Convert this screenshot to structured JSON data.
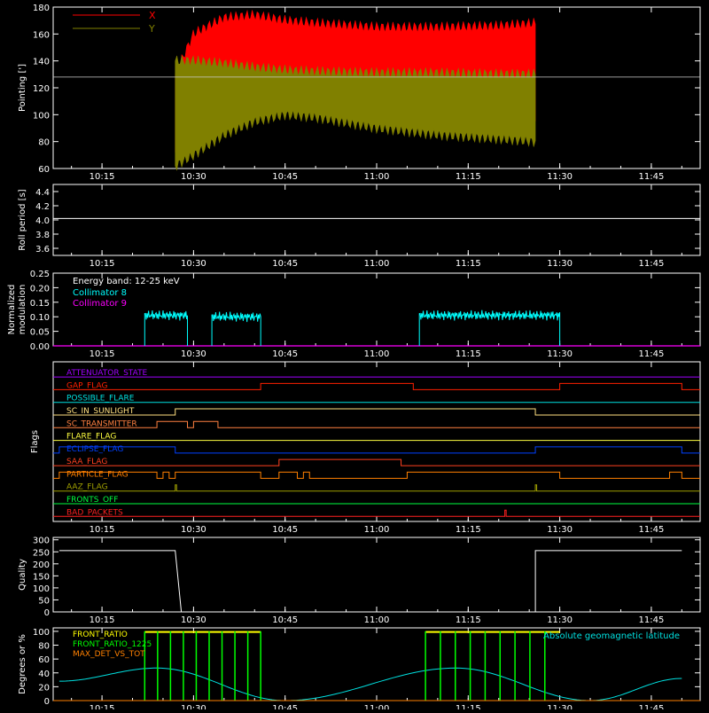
{
  "colors": {
    "background": "#000000",
    "axis": "#ffffff",
    "x_pointing": "#ff0000",
    "y_pointing": "#808000",
    "collimator8": "#00ffff",
    "collimator9": "#ff00ff",
    "front_ratio": "#ffff00",
    "front_ratio_1225": "#00ff00",
    "max_det_vs_tot": "#ff8000",
    "geomag": "#00e0e0"
  },
  "time_axis": {
    "ticks": [
      "10:15",
      "10:30",
      "10:45",
      "11:00",
      "11:15",
      "11:30",
      "11:45"
    ],
    "tick_minutes": [
      615,
      630,
      645,
      660,
      675,
      690,
      705
    ],
    "range_minutes": [
      607,
      713
    ]
  },
  "panels": {
    "pointing": {
      "ylabel": "Pointing [']",
      "yticks": [
        "60",
        "80",
        "100",
        "120",
        "140",
        "160",
        "180"
      ],
      "yrange": [
        60,
        180
      ],
      "legend": [
        {
          "name": "X",
          "color": "#ff0000"
        },
        {
          "name": "Y",
          "color": "#808000"
        }
      ]
    },
    "roll": {
      "ylabel": "Roll period [s]",
      "yticks": [
        "3.6",
        "3.8",
        "4.0",
        "4.2",
        "4.4"
      ],
      "yrange": [
        3.5,
        4.5
      ]
    },
    "modulation": {
      "ylabel_line1": "Normalized",
      "ylabel_line2": "modulation",
      "yticks": [
        "0.00",
        "0.05",
        "0.10",
        "0.15",
        "0.20",
        "0.25"
      ],
      "yrange": [
        0,
        0.25
      ],
      "legend_title": "Energy band: 12-25 keV",
      "legend": [
        {
          "name": "Collimator 8",
          "color": "#00ffff"
        },
        {
          "name": "Collimator 9",
          "color": "#ff00ff"
        }
      ]
    },
    "flags": {
      "ylabel": "Flags",
      "items": [
        {
          "name": "ATTENUATOR_STATE",
          "color": "#a000ff"
        },
        {
          "name": "GAP_FLAG",
          "color": "#ff2000"
        },
        {
          "name": "POSSIBLE_FLARE",
          "color": "#00e0e0"
        },
        {
          "name": "SC_IN_SUNLIGHT",
          "color": "#ffe080"
        },
        {
          "name": "SC_TRANSMITTER",
          "color": "#ff8040"
        },
        {
          "name": "FLARE_FLAG",
          "color": "#ffff40"
        },
        {
          "name": "ECLIPSE_FLAG",
          "color": "#0040ff"
        },
        {
          "name": "SAA_FLAG",
          "color": "#ff4020"
        },
        {
          "name": "PARTICLE_FLAG",
          "color": "#ff8000"
        },
        {
          "name": "AAZ_FLAG",
          "color": "#a0a000"
        },
        {
          "name": "FRONTS_OFF",
          "color": "#00ff40"
        },
        {
          "name": "BAD_PACKETS",
          "color": "#ff2020"
        }
      ]
    },
    "quality": {
      "ylabel": "Quality",
      "yticks": [
        "0",
        "50",
        "100",
        "150",
        "200",
        "250",
        "300"
      ],
      "yrange": [
        0,
        310
      ]
    },
    "degrees": {
      "ylabel": "Degrees or %",
      "yticks": [
        "0",
        "20",
        "40",
        "60",
        "80",
        "100"
      ],
      "yrange": [
        0,
        105
      ],
      "legend": [
        {
          "name": "FRONT_RATIO",
          "color": "#ffff00"
        },
        {
          "name": "FRONT_RATIO_1225",
          "color": "#00ff00"
        },
        {
          "name": "MAX_DET_VS_TOT",
          "color": "#ff8000"
        }
      ],
      "annotation": "Absolute geomagnetic latitude"
    }
  },
  "chart_data": {
    "type": "line",
    "x_unit": "time (HH:MM)",
    "pointing": {
      "x": [
        "10:27",
        "10:30",
        "10:35",
        "10:40",
        "10:45",
        "10:50",
        "11:00",
        "11:10",
        "11:20",
        "11:26"
      ],
      "series": [
        {
          "name": "X",
          "min": [
            72,
            85,
            100,
            108,
            110,
            105,
            100,
            98,
            97,
            95
          ],
          "max": [
            130,
            160,
            172,
            174,
            170,
            168,
            165,
            165,
            166,
            168
          ]
        },
        {
          "name": "Y",
          "min": [
            62,
            70,
            85,
            95,
            100,
            98,
            90,
            85,
            82,
            80
          ],
          "max": [
            140,
            140,
            138,
            135,
            133,
            132,
            131,
            131,
            130,
            130
          ]
        }
      ],
      "reference": 128
    },
    "roll": {
      "x": [
        "10:08",
        "11:50"
      ],
      "values": [
        4.02,
        4.02
      ]
    },
    "modulation": {
      "collimator8_segments": [
        {
          "start": "10:22",
          "end": "10:29",
          "level": 0.105
        },
        {
          "start": "10:33",
          "end": "10:41",
          "level": 0.1
        },
        {
          "start": "11:07",
          "end": "11:30",
          "level": 0.105
        }
      ],
      "collimator9": 0.0
    },
    "flags": [
      {
        "name": "ATTENUATOR_STATE",
        "states": []
      },
      {
        "name": "GAP_FLAG",
        "states": [
          [
            "10:41",
            "11:06"
          ],
          [
            "11:30",
            "11:50"
          ]
        ]
      },
      {
        "name": "POSSIBLE_FLARE",
        "states": []
      },
      {
        "name": "SC_IN_SUNLIGHT",
        "states": [
          [
            "10:27",
            "11:26"
          ]
        ]
      },
      {
        "name": "SC_TRANSMITTER",
        "states": [
          [
            "10:24",
            "10:29"
          ],
          [
            "10:30",
            "10:34"
          ]
        ]
      },
      {
        "name": "FLARE_FLAG",
        "states": []
      },
      {
        "name": "ECLIPSE_FLAG",
        "states": [
          [
            "10:08",
            "10:27"
          ],
          [
            "11:26",
            "11:50"
          ]
        ]
      },
      {
        "name": "SAA_FLAG",
        "states": [
          [
            "10:44",
            "11:04"
          ]
        ]
      },
      {
        "name": "PARTICLE_FLAG",
        "states": [
          [
            "10:08",
            "10:24"
          ],
          [
            "10:25",
            "10:26"
          ],
          [
            "10:27",
            "10:41"
          ],
          [
            "10:44",
            "10:47"
          ],
          [
            "10:48",
            "10:49"
          ],
          [
            "11:05",
            "11:30"
          ],
          [
            "11:48",
            "11:50"
          ]
        ]
      },
      {
        "name": "AAZ_FLAG",
        "states": [
          [
            "10:27",
            "10:27"
          ],
          [
            "11:26",
            "11:26"
          ]
        ]
      },
      {
        "name": "FRONTS_OFF",
        "states": []
      },
      {
        "name": "BAD_PACKETS",
        "states": [
          [
            "11:21",
            "11:21"
          ]
        ]
      }
    ],
    "quality": {
      "x": [
        "10:08",
        "10:27",
        "10:28",
        "11:26",
        "11:26",
        "11:50"
      ],
      "values": [
        255,
        255,
        0,
        0,
        255,
        255
      ]
    },
    "degrees": {
      "geomag_latitude": {
        "x": [
          "10:08",
          "10:24",
          "10:45",
          "11:13",
          "11:35",
          "11:50"
        ],
        "values": [
          28,
          47,
          0,
          47,
          0,
          32
        ]
      },
      "front_ratio_1225_segments": [
        [
          "10:22",
          "10:41"
        ],
        [
          "11:08",
          "11:30"
        ]
      ]
    }
  }
}
